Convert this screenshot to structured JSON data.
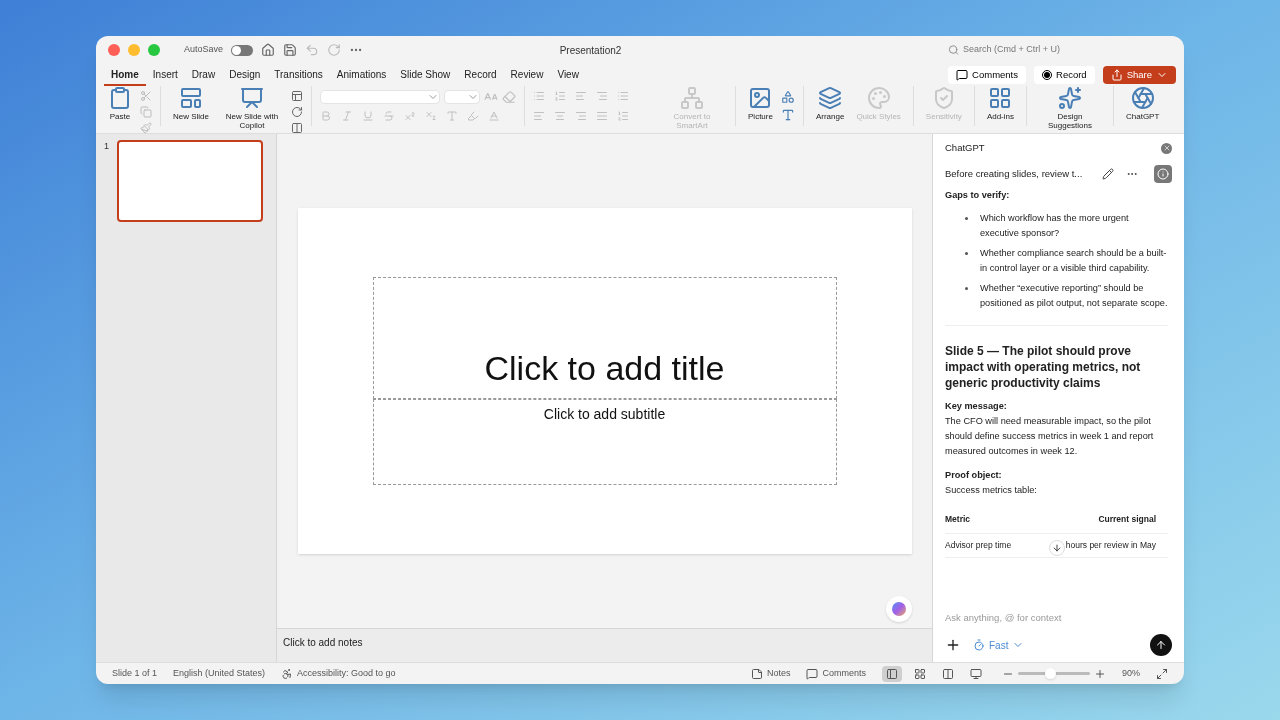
{
  "window": {
    "title": "Presentation2",
    "autosave": {
      "label": "AutoSave",
      "on": false
    },
    "search": {
      "placeholder": "Search (Cmd + Ctrl + U)"
    }
  },
  "tabs": [
    {
      "label": "Home",
      "selected": true
    },
    {
      "label": "Insert",
      "selected": false
    },
    {
      "label": "Draw",
      "selected": false
    },
    {
      "label": "Design",
      "selected": false
    },
    {
      "label": "Transitions",
      "selected": false
    },
    {
      "label": "Animations",
      "selected": false
    },
    {
      "label": "Slide Show",
      "selected": false
    },
    {
      "label": "Record",
      "selected": false
    },
    {
      "label": "Review",
      "selected": false
    },
    {
      "label": "View",
      "selected": false
    }
  ],
  "header_buttons": {
    "comments": "Comments",
    "record": "Record",
    "share": "Share"
  },
  "ribbon": {
    "clipboard": [
      {
        "label": "Paste",
        "disabled": false
      }
    ],
    "slides": [
      {
        "label": "New Slide",
        "disabled": false
      },
      {
        "label": "New Slide with Copilot",
        "disabled": false
      }
    ],
    "insert": [
      {
        "label": "Convert to SmartArt",
        "disabled": true
      },
      {
        "label": "Picture",
        "disabled": false
      },
      {
        "label": "Arrange",
        "disabled": false
      },
      {
        "label": "Quick Styles",
        "disabled": true
      },
      {
        "label": "Sensitivity",
        "disabled": true
      },
      {
        "label": "Add-ins",
        "disabled": false
      },
      {
        "label": "Design Suggestions",
        "disabled": false
      },
      {
        "label": "ChatGPT",
        "disabled": false
      }
    ]
  },
  "thumbnails": [
    {
      "number": "1",
      "selected": true
    }
  ],
  "slide": {
    "title_placeholder": "Click to add title",
    "subtitle_placeholder": "Click to add subtitle"
  },
  "notes": {
    "placeholder": "Click to add notes"
  },
  "chat": {
    "title": "ChatGPT",
    "conversation": "Before creating slides, review t...",
    "gaps_heading": "Gaps to verify:",
    "gaps": [
      "Which workflow has the more urgent executive sponsor?",
      "Whether compliance search should be a built-in control layer or a visible third capability.",
      "Whether “executive reporting” should be positioned as pilot output, not separate scope."
    ],
    "slide_heading": "Slide 5 — The pilot should prove impact with operating metrics, not generic productivity claims",
    "key_label": "Key message:",
    "key_text": "The CFO will need measurable impact, so the pilot should define success metrics in week 1 and report measured outcomes in week 12.",
    "proof_label": "Proof object:",
    "proof_text": "Success metrics table:",
    "table": {
      "columns": [
        "Metric",
        "Current signal"
      ],
      "rows": [
        [
          "Advisor prep time",
          "hours per review in May"
        ]
      ]
    },
    "input": {
      "placeholder": "Ask anything, @ for context"
    },
    "mode": "Fast"
  },
  "status_bar": {
    "slide": "Slide 1 of 1",
    "language": "English (United States)",
    "accessibility": "Accessibility: Good to go",
    "notes": "Notes",
    "comments": "Comments",
    "views": [
      {
        "selected": true
      },
      {
        "selected": false
      },
      {
        "selected": false
      },
      {
        "selected": false
      }
    ],
    "zoom": {
      "level": 0.45,
      "reading": "90%"
    }
  }
}
